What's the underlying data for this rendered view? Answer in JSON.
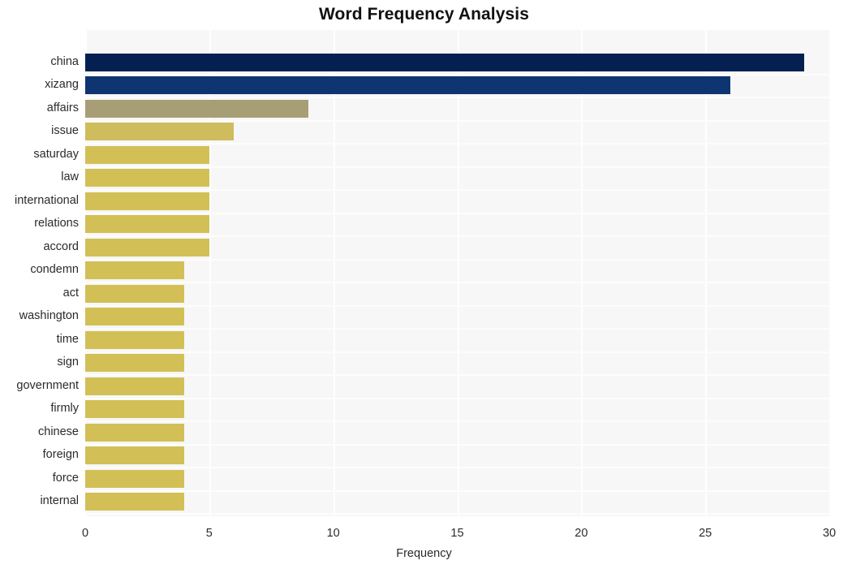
{
  "chart_data": {
    "type": "bar",
    "orientation": "horizontal",
    "title": "Word Frequency Analysis",
    "xlabel": "Frequency",
    "ylabel": "",
    "xlim": [
      0,
      30
    ],
    "xticks": [
      0,
      5,
      10,
      15,
      20,
      25,
      30
    ],
    "xtick_labels": [
      "0",
      "5",
      "10",
      "15",
      "20",
      "25",
      "30"
    ],
    "grid": true,
    "grid_axis": "both",
    "legend": false,
    "categories": [
      "china",
      "xizang",
      "affairs",
      "issue",
      "saturday",
      "law",
      "international",
      "relations",
      "accord",
      "condemn",
      "act",
      "washington",
      "time",
      "sign",
      "government",
      "firmly",
      "chinese",
      "foreign",
      "force",
      "internal"
    ],
    "values": [
      29,
      26,
      9,
      6,
      5,
      5,
      5,
      5,
      5,
      4,
      4,
      4,
      4,
      4,
      4,
      4,
      4,
      4,
      4,
      4
    ],
    "bar_colors": [
      "#042050",
      "#0f3472",
      "#a89e76",
      "#cfbc5d",
      "#d2c056",
      "#d2c056",
      "#d2c056",
      "#d2c056",
      "#d2c056",
      "#d2c056",
      "#d2c056",
      "#d2c056",
      "#d2c056",
      "#d2c056",
      "#d2c056",
      "#d2c056",
      "#d2c056",
      "#d2c056",
      "#d2c056",
      "#d2c056"
    ],
    "plot_background": "#f7f7f7",
    "figure_background": "#ffffff",
    "gridline_color": "#ffffff",
    "text_color": "#2b2b2b",
    "title_color": "#111111"
  }
}
